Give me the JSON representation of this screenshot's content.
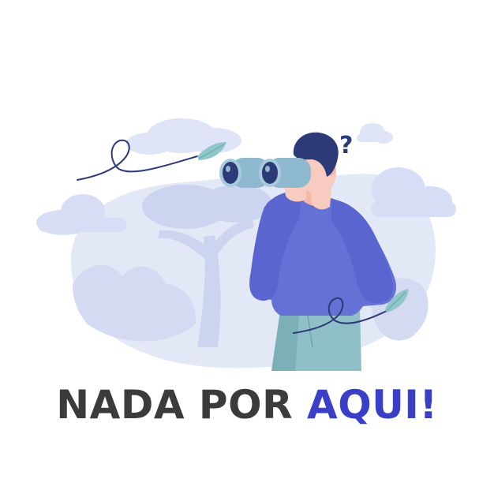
{
  "caption": {
    "part1": "NADA POR ",
    "part2": "AQUI!"
  },
  "illustration": {
    "question_mark": "?",
    "icons": [
      "person-with-binoculars-icon",
      "cloud-icon",
      "leaf-icon",
      "tree-icon",
      "question-mark-icon"
    ]
  },
  "colors": {
    "text_dark": "#3b3b3b",
    "text_accent": "#3a3fc8",
    "sweater": "#6671d6",
    "sweater_dark": "#4e58c4",
    "hair": "#2d3a78",
    "binoculars": "#8fb9cf",
    "lens": "#2d3a78",
    "skin": "#f7cbbf",
    "pants": "#8fc0c8",
    "background_blob": "#e3e8f7",
    "cloud": "#d7ddf4",
    "leaf": "#8fc6c9"
  }
}
